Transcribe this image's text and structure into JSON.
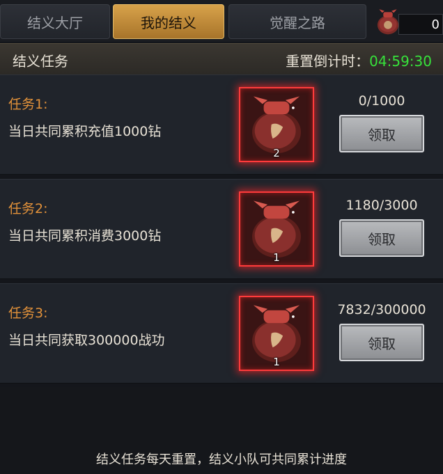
{
  "tabs": [
    {
      "label": "结义大厅",
      "active": false
    },
    {
      "label": "我的结义",
      "active": true
    },
    {
      "label": "觉醒之路",
      "active": false
    }
  ],
  "currency": {
    "icon": "wine-jar-icon",
    "value": "0"
  },
  "header": {
    "title": "结义任务",
    "reset_label": "重置倒计时：",
    "reset_time": "04:59:30"
  },
  "tasks": [
    {
      "name": "任务1:",
      "desc": "当日共同累积充值1000钻",
      "reward_icon": "wine-jar-icon",
      "reward_count": "2",
      "progress": "0/1000",
      "claim_label": "领取"
    },
    {
      "name": "任务2:",
      "desc": "当日共同累积消费3000钻",
      "reward_icon": "wine-jar-icon",
      "reward_count": "1",
      "progress": "1180/3000",
      "claim_label": "领取"
    },
    {
      "name": "任务3:",
      "desc": "当日共同获取300000战功",
      "reward_icon": "wine-jar-icon",
      "reward_count": "1",
      "progress": "7832/300000",
      "claim_label": "领取"
    }
  ],
  "footer": {
    "note": "结义任务每天重置，结义小队可共同累计进度"
  },
  "colors": {
    "accent_gold": "#d8a24a",
    "task_name": "#e3923a",
    "timer_green": "#37e23b",
    "reward_border": "#ff3b3b"
  }
}
